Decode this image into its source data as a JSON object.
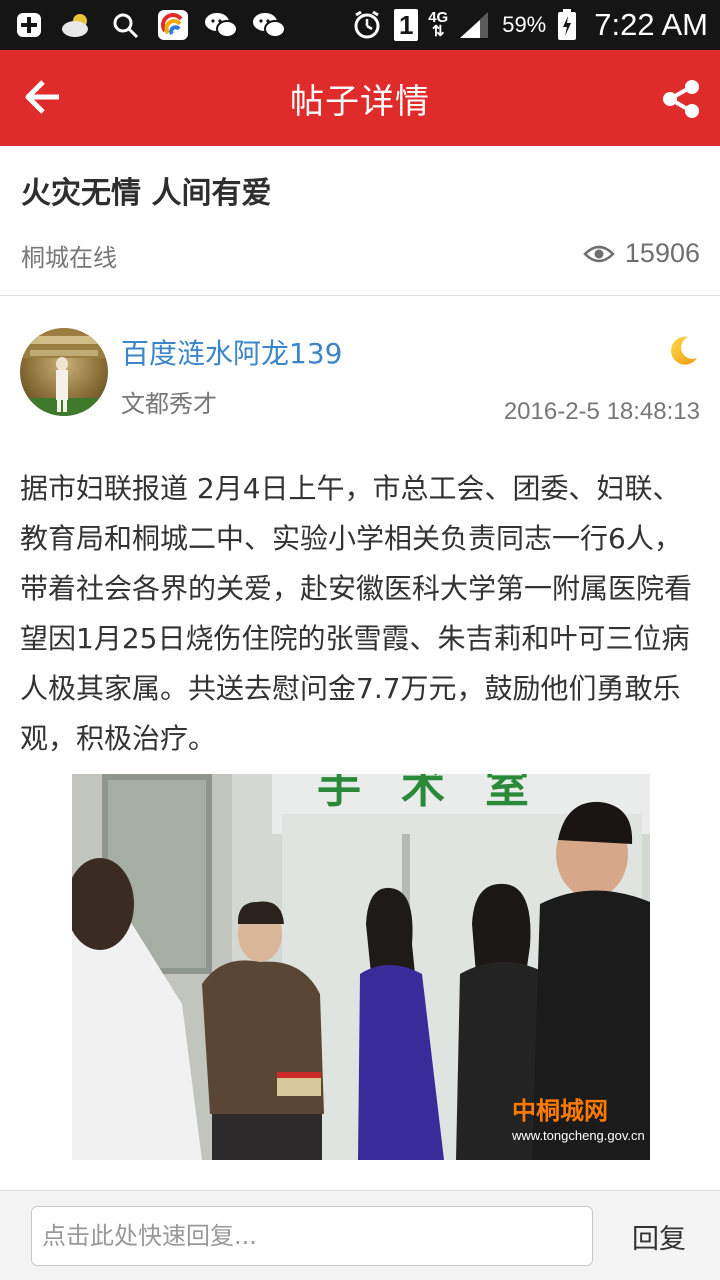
{
  "status_bar": {
    "battery": "59%",
    "time": "7:22 AM",
    "network": "4G",
    "sim_slot": "1",
    "icons": [
      "plus-icon",
      "weather-icon",
      "search-icon",
      "app-icon",
      "wechat-icon",
      "wechat-icon",
      "alarm-icon",
      "sim-icon",
      "network-icon",
      "signal-icon",
      "battery-icon"
    ]
  },
  "header": {
    "title": "帖子详情",
    "accent_color": "#e02b2b"
  },
  "post": {
    "title": "火灾无情 人间有爱",
    "source": "桐城在线",
    "views": "15906"
  },
  "author": {
    "name": "百度涟水阿龙139",
    "rank": "文都秀才",
    "time": "2016-2-5 18:48:13"
  },
  "body": {
    "text": "据市妇联报道 2月4日上午，市总工会、团委、妇联、教育局和桐城二中、实验小学相关负责同志一行6人，带着社会各界的关爱，赴安徽医科大学第一附属医院看望因1月25日烧伤住院的张雪霞、朱吉莉和叶可三位病人极其家属。共送去慰问金7.7万元，鼓励他们勇敢乐观，积极治疗。",
    "image_sign": "手术室",
    "watermark_name": "中桐城网",
    "watermark_url": "www.tongcheng.gov.cn"
  },
  "reply": {
    "placeholder": "点击此处快速回复...",
    "button_label": "回复"
  }
}
